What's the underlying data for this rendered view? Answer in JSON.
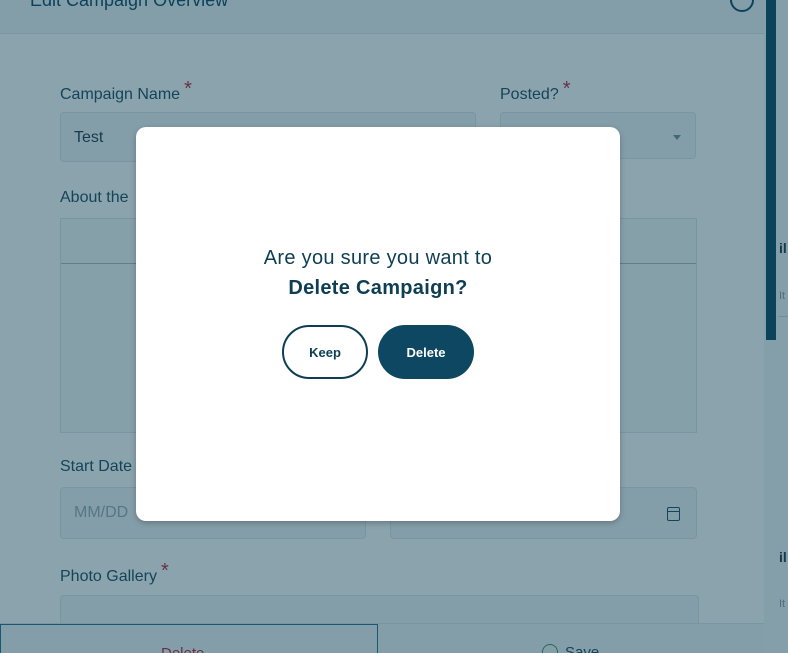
{
  "header": {
    "title": "Edit Campaign Overview"
  },
  "form": {
    "campaign_name_label": "Campaign Name",
    "campaign_name_value": "Test",
    "posted_label": "Posted?",
    "about_label": "About the",
    "start_date_label": "Start Date",
    "start_date_placeholder": "MM/DD",
    "photo_gallery_label": "Photo Gallery",
    "required_mark": "*"
  },
  "footer": {
    "delete_label": "Delete",
    "save_label": "Save"
  },
  "sidebar": {
    "item_text": "il",
    "item_sub": "It"
  },
  "modal": {
    "question_line1": "Are you sure you want to",
    "question_line2": "Delete Campaign?",
    "keep_label": "Keep",
    "delete_label": "Delete"
  }
}
